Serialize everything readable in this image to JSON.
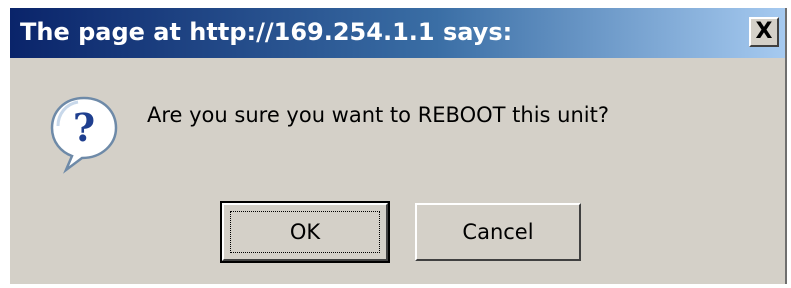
{
  "dialog": {
    "title": "The page at http://169.254.1.1 says:",
    "close_glyph": "X",
    "icon": "question-icon",
    "icon_glyph": "?",
    "message": "Are you sure you want to REBOOT this unit?",
    "buttons": {
      "ok_label": "OK",
      "cancel_label": "Cancel"
    }
  },
  "colors": {
    "titlebar_start": "#0a246a",
    "titlebar_end": "#a6caf0",
    "dialog_bg": "#d4d0c8"
  }
}
